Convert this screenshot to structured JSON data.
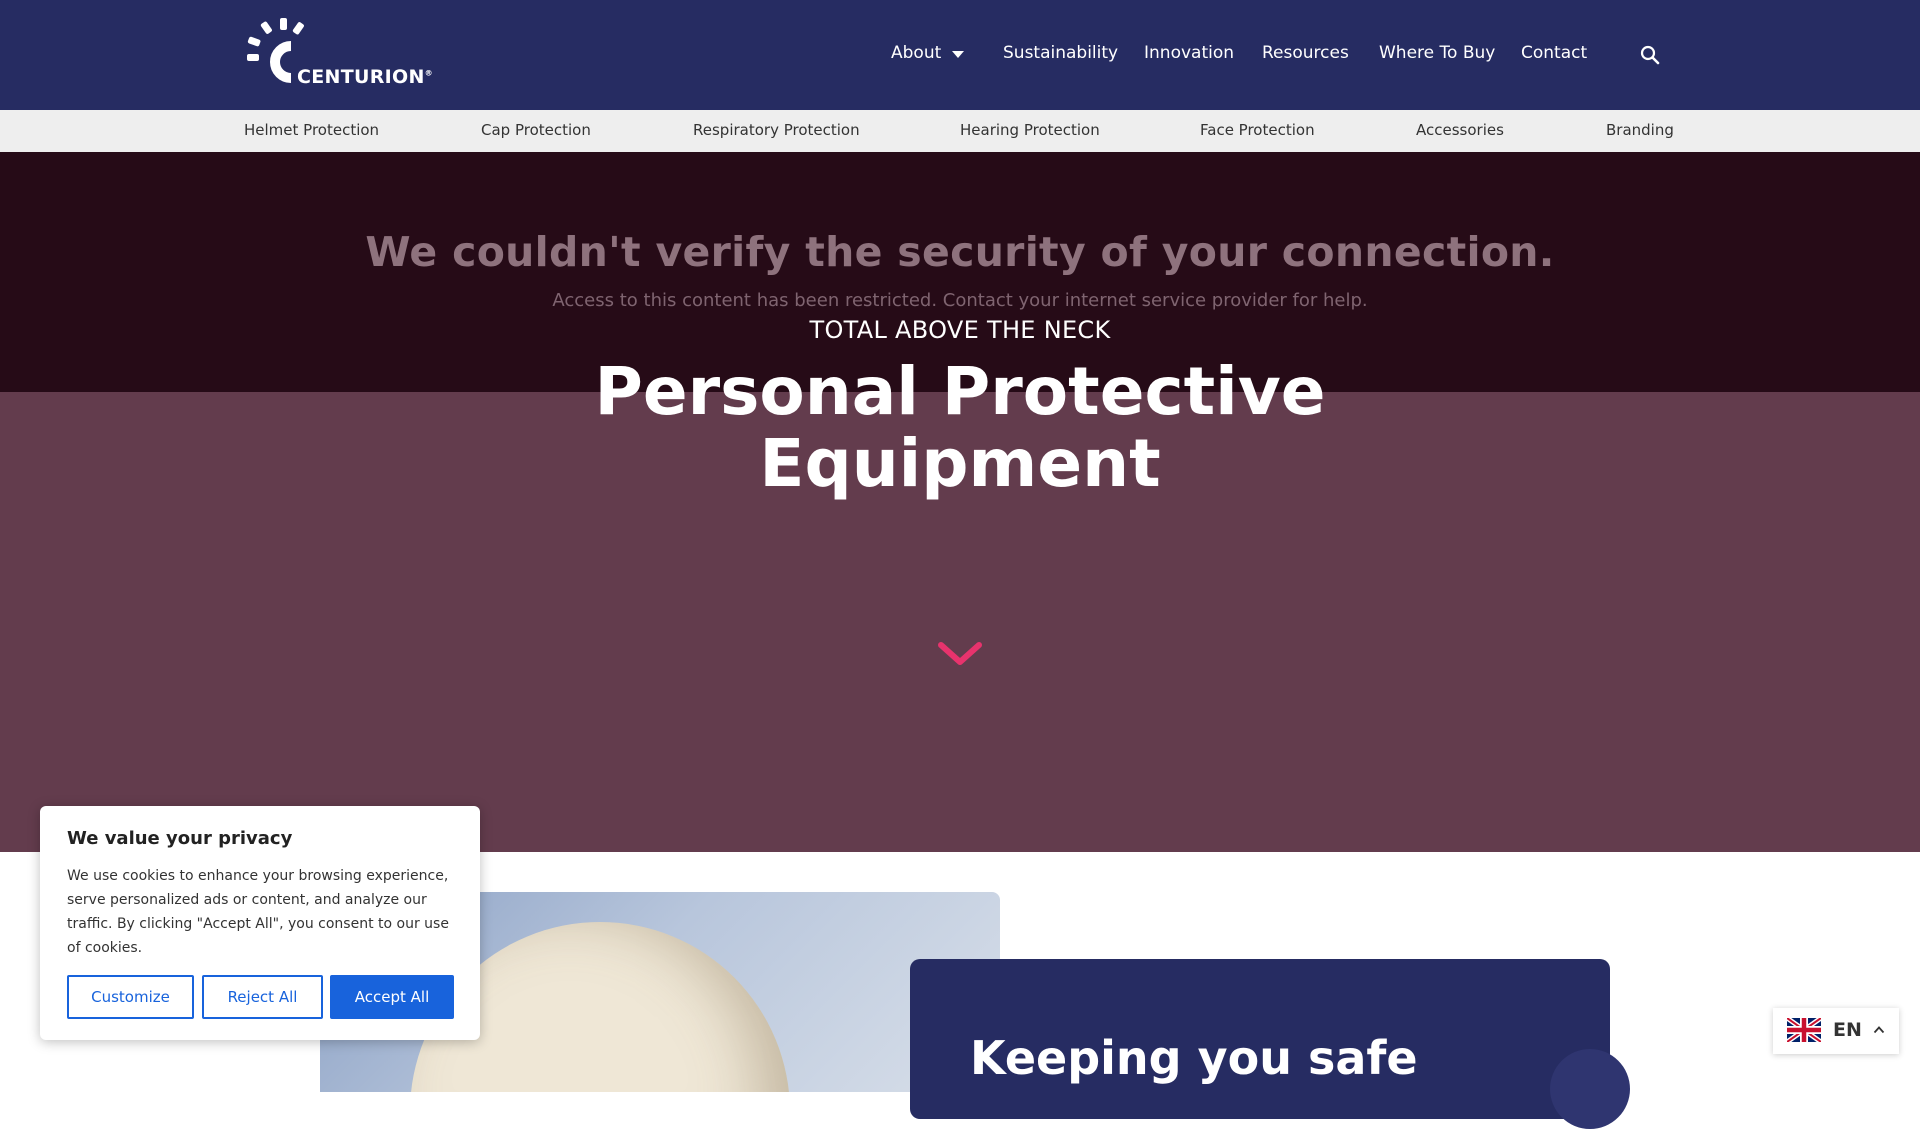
{
  "brand": {
    "logo_text": "CENTURION",
    "registered": "®"
  },
  "nav": {
    "items": [
      "About",
      "Sustainability",
      "Innovation",
      "Resources",
      "Where To Buy",
      "Contact"
    ]
  },
  "subnav": {
    "items": [
      "Helmet Protection",
      "Cap Protection",
      "Respiratory Protection",
      "Hearing Protection",
      "Face Protection",
      "Accessories",
      "Branding"
    ]
  },
  "error": {
    "title": "We couldn't verify the security of your connection.",
    "subtitle": "Access to this content has been restricted. Contact your internet service provider for help."
  },
  "hero": {
    "kicker": "TOTAL ABOVE THE NECK",
    "title_line1": "Personal Protective",
    "title_line2": "Equipment"
  },
  "content": {
    "card_title": "Keeping you safe"
  },
  "cookie": {
    "title": "We value your privacy",
    "body": "We use cookies to enhance your browsing experience, serve personalized ads or content, and analyze our traffic. By clicking \"Accept All\", you consent to our use of cookies.",
    "customize": "Customize",
    "reject": "Reject All",
    "accept": "Accept All"
  },
  "language": {
    "code": "EN"
  },
  "colors": {
    "nav_bg": "#262c62",
    "hero_bg": "#633c4d",
    "overlay_bg": "#260b17",
    "accent": "#e8336d",
    "cookie_button": "#1863dc"
  },
  "icons": {
    "search": "search-icon",
    "about_caret": "caret-down-icon",
    "scroll": "chevron-down-icon",
    "flag": "uk-flag-icon",
    "lang_caret": "chevron-up-icon"
  }
}
